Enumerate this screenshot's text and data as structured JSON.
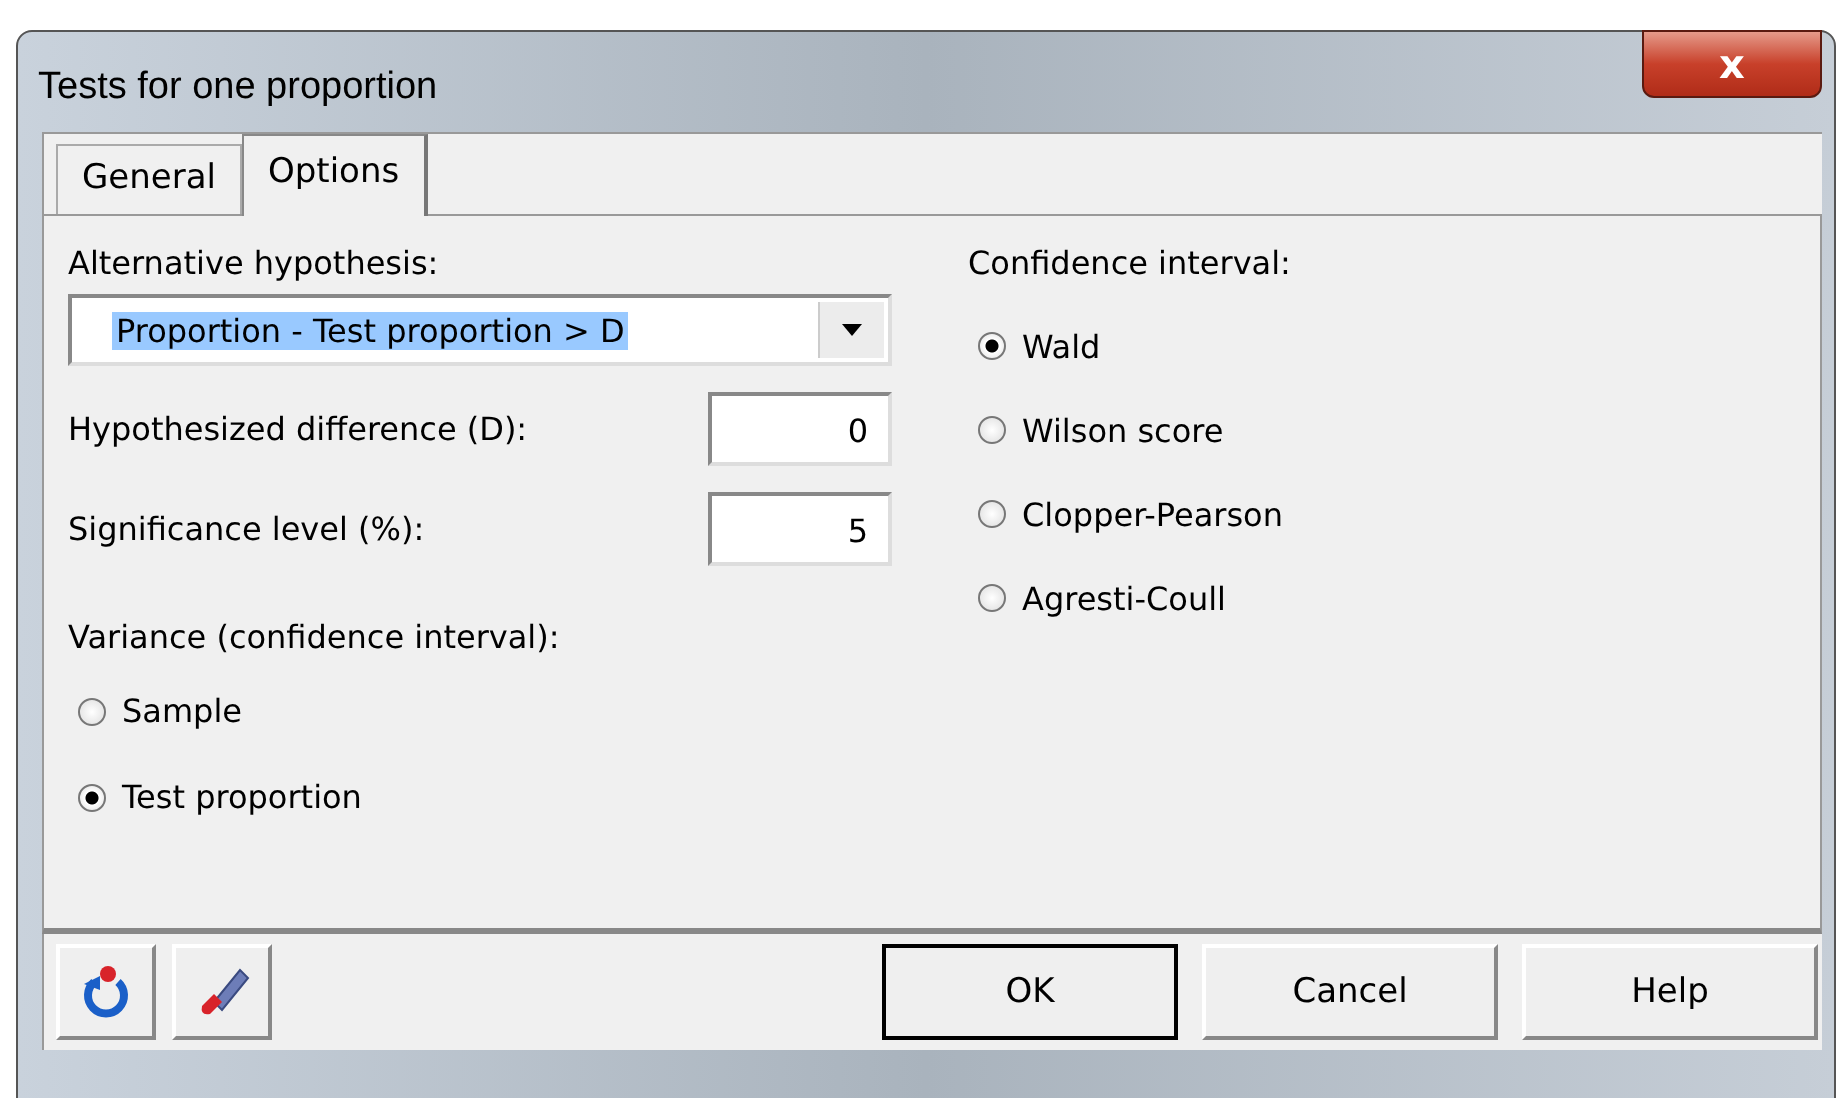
{
  "window": {
    "title": "Tests for one proportion",
    "close": "x"
  },
  "tabs": [
    {
      "label": "General",
      "selected": false
    },
    {
      "label": "Options",
      "selected": true
    }
  ],
  "alternative_hypothesis": {
    "label": "Alternative hypothesis:",
    "value": "Proportion - Test proportion > D",
    "highlighted": true
  },
  "fields": [
    {
      "label": "Hypothesized difference (D):",
      "value": "0"
    },
    {
      "label": "Significance level (%):",
      "value": "5"
    }
  ],
  "variance": {
    "label": "Variance (confidence interval):",
    "options": [
      {
        "label": "Sample",
        "selected": false
      },
      {
        "label": "Test proportion",
        "selected": true
      }
    ]
  },
  "confidence_interval": {
    "label": "Confidence interval:",
    "options": [
      {
        "label": "Wald",
        "selected": true
      },
      {
        "label": "Wilson score",
        "selected": false
      },
      {
        "label": "Clopper-Pearson",
        "selected": false
      },
      {
        "label": "Agresti-Coull",
        "selected": false
      }
    ]
  },
  "buttons": [
    {
      "label": "OK",
      "default": true
    },
    {
      "label": "Cancel",
      "default": false
    },
    {
      "label": "Help",
      "default": false
    }
  ]
}
